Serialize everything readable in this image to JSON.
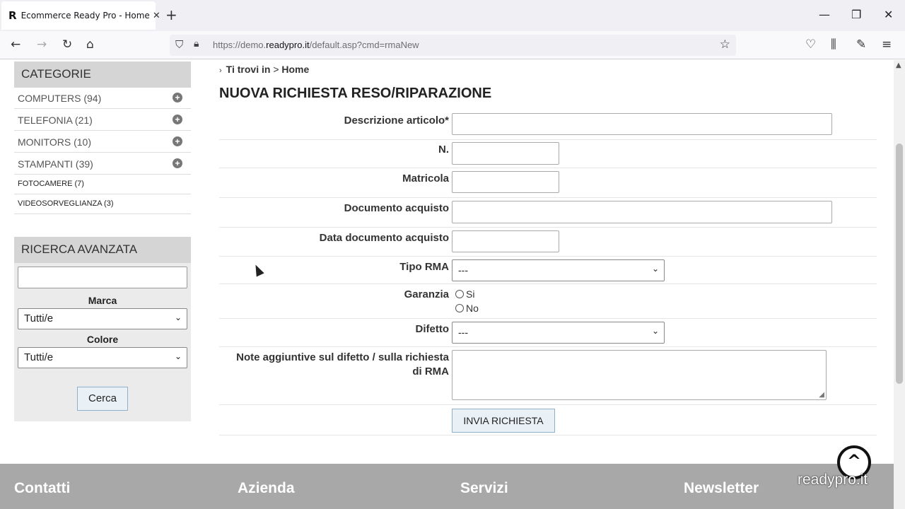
{
  "browser": {
    "tab_title": "Ecommerce Ready Pro - Home",
    "favicon_letter": "R",
    "url_prefix": "https://demo.",
    "url_host": "readypro.it",
    "url_path": "/default.asp?cmd=rmaNew"
  },
  "sidebar": {
    "categories_title": "CATEGORIE",
    "categories": [
      {
        "label": "COMPUTERS (94)"
      },
      {
        "label": "TELEFONIA (21)"
      },
      {
        "label": "MONITORS (10)"
      },
      {
        "label": "STAMPANTI (39)"
      },
      {
        "label": "FOTOCAMERE (7)"
      },
      {
        "label": "VIDEOSORVEGLIANZA (3)"
      }
    ],
    "advanced_title": "RICERCA AVANZATA",
    "brand_label": "Marca",
    "brand_value": "Tutti/e",
    "color_label": "Colore",
    "color_value": "Tutti/e",
    "search_button": "Cerca"
  },
  "main": {
    "breadcrumb_prefix": "Ti trovi in",
    "breadcrumb_sep": ">",
    "breadcrumb_home": "Home",
    "title": "NUOVA RICHIESTA RESO/RIPARAZIONE",
    "fields": {
      "descrizione": "Descrizione articolo*",
      "numero": "N.",
      "matricola": "Matricola",
      "documento": "Documento acquisto",
      "data_documento": "Data documento acquisto",
      "tipo_rma": "Tipo RMA",
      "tipo_rma_value": "---",
      "garanzia": "Garanzia",
      "garanzia_si": "Si",
      "garanzia_no": "No",
      "difetto": "Difetto",
      "difetto_value": "---",
      "note_line1": "Note aggiuntive sul difetto / sulla richiesta",
      "note_line2": "di RMA"
    },
    "submit_button": "INVIA RICHIESTA"
  },
  "footer": {
    "contatti": "Contatti",
    "azienda": "Azienda",
    "servizi": "Servizi",
    "newsletter": "Newsletter",
    "brand": "readypro.it"
  }
}
